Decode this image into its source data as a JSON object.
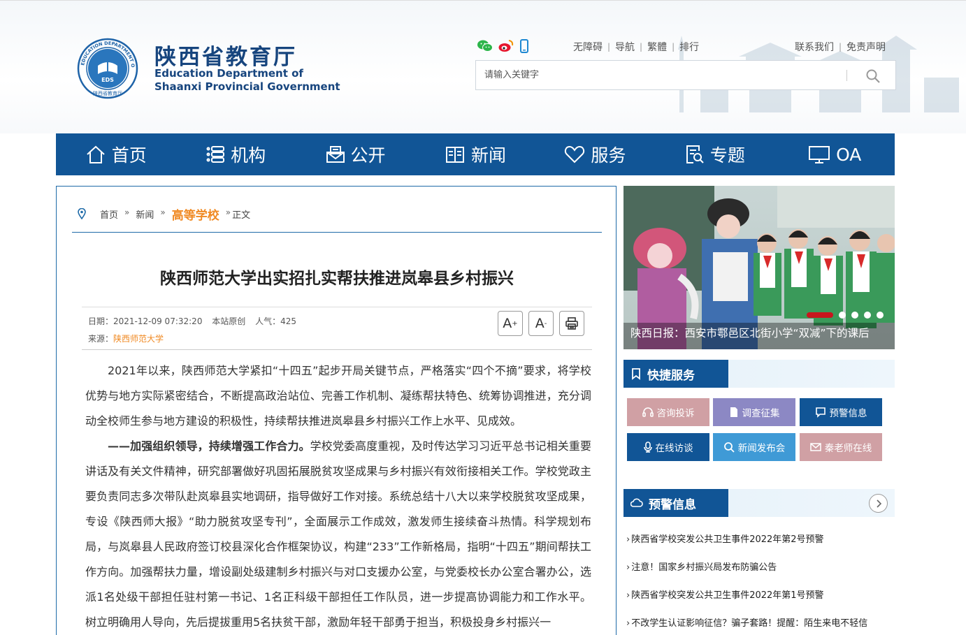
{
  "header": {
    "site_name_cn": "陕西省教育厅",
    "site_name_en_line1": "Education Department of",
    "site_name_en_line2": "Shaanxi Provincial Government",
    "seal_text": "EDUCATION DEPARTMENT OF SHAANXI · 陕西省教育厅 · EDS",
    "links_left": [
      "无障碍",
      "导航",
      "繁體",
      "排行"
    ],
    "links_right": [
      "联系我们",
      "免责声明"
    ],
    "search_placeholder": "请输入关键字",
    "social_icons": [
      "wechat-icon",
      "weibo-icon",
      "mobile-icon"
    ]
  },
  "nav": [
    {
      "label": "首页",
      "icon": "home-icon"
    },
    {
      "label": "机构",
      "icon": "list-icon"
    },
    {
      "label": "公开",
      "icon": "mailbox-icon"
    },
    {
      "label": "新闻",
      "icon": "book-icon"
    },
    {
      "label": "服务",
      "icon": "heart-icon"
    },
    {
      "label": "专题",
      "icon": "document-search-icon"
    },
    {
      "label": "OA",
      "icon": "monitor-icon"
    }
  ],
  "breadcrumb": {
    "items": [
      "首页",
      "新闻"
    ],
    "current": "高等学校",
    "tail": "正文"
  },
  "article": {
    "title": "陕西师范大学出实招扎实帮扶推进岚皋县乡村振兴",
    "date": "日期：2021-12-09 07:32:20",
    "origin": "本站原创",
    "views": "人气：425",
    "source_label": "来源：",
    "source": "陕西师范大学",
    "tools": [
      "A+",
      "A-",
      "print"
    ],
    "para1": "2021年以来，陕西师范大学紧扣“十四五”起步开局关键节点，严格落实“四个不摘”要求，将学校优势与地方实际紧密结合，不断提高政治站位、完善工作机制、凝练帮扶特色、统筹协调推进，充分调动全校师生参与地方建设的积极性，持续帮扶推进岚皋县乡村振兴工作上水平、见成效。",
    "para2_bold": "——加强组织领导，持续增强工作合力。",
    "para2": "学校党委高度重视，及时传达学习习近平总书记相关重要讲话及有关文件精神，研究部署做好巩固拓展脱贫攻坚成果与乡村振兴有效衔接相关工作。学校党政主要负责同志多次带队赴岚皋县实地调研，指导做好工作对接。系统总结十八大以来学校脱贫攻坚成果，专设《陕西师大报》“助力脱贫攻坚专刊”，全面展示工作成效，激发师生接续奋斗热情。科学规划布局，与岚皋县人民政府签订校县深化合作框架协议，构建“233”工作新格局，指明“十四五”期间帮扶工作方向。加强帮扶力量，增设副处级建制乡村振兴与对口支援办公室，与党委校长办公室合署办公，选派1名处级干部担任驻村第一书记、1名正科级干部担任工作队员，进一步提高协调能力和工作水平。树立明确用人导向，先后提拔重用5名扶贫干部，激励年轻干部勇于担当，积极投身乡村振兴一"
  },
  "slideshow": {
    "caption": "陕西日报：西安市鄠邑区北街小学“双减”下的课后",
    "active_index": 0,
    "count": 5
  },
  "quick_service": {
    "title": "快捷服务",
    "buttons": [
      {
        "label": "咨询投诉",
        "color": "#d0a0a4",
        "icon": "headset-icon"
      },
      {
        "label": "调查征集",
        "color": "#8c88c4",
        "icon": "file-icon"
      },
      {
        "label": "预警信息",
        "color": "#115596",
        "icon": "chat-icon"
      },
      {
        "label": "在线访谈",
        "color": "#115596",
        "icon": "mic-icon"
      },
      {
        "label": "新闻发布会",
        "color": "#3f9ad6",
        "icon": "search-icon"
      },
      {
        "label": "秦老师在线",
        "color": "#d0a0a4",
        "icon": "mail-icon"
      }
    ]
  },
  "warnings": {
    "title": "预警信息",
    "items": [
      "陕西省学校突发公共卫生事件2022年第2号预警",
      "注意！国家乡村振兴局发布防骗公告",
      "陕西省学校突发公共卫生事件2022年第1号预警",
      "不改学生认证影响征信？骗子套路！提醒：陌生来电不轻信"
    ]
  },
  "colors": {
    "primary": "#115596",
    "accent_orange": "#f08a24",
    "alert_red": "#c8161d"
  }
}
